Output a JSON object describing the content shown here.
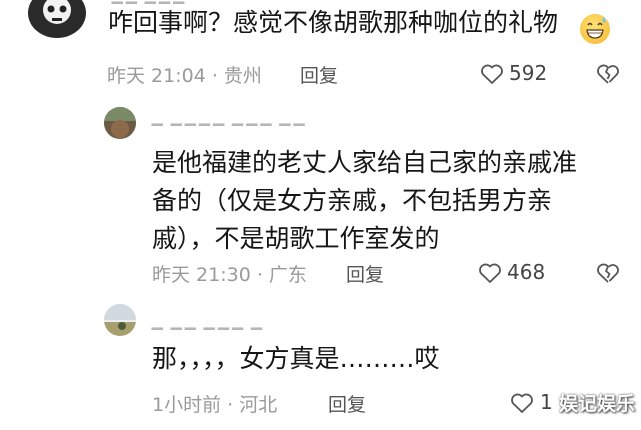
{
  "comments": [
    {
      "text_lines": [
        "咋回事啊？感觉不像胡歌那种咖位的礼物"
      ],
      "time": "昨天 21:04",
      "location": "贵州",
      "reply_label": "回复",
      "likes": "592"
    },
    {
      "text_lines": [
        "是他福建的老丈人家给自己家的亲戚准",
        "备的（仅是女方亲戚，不包括男方亲",
        "戚），不是胡歌工作室发的"
      ],
      "time": "昨天 21:30",
      "location": "广东",
      "reply_label": "回复",
      "likes": "468"
    },
    {
      "text_lines": [
        "那，，，，女方真是………哎"
      ],
      "time": "1小时前",
      "location": "河北",
      "reply_label": "回复",
      "likes": "1"
    }
  ],
  "meta_separator": " · ",
  "icons": {
    "like": "heart-outline-icon",
    "dislike": "broken-heart-icon",
    "emoji": "grinning-sweat-emoji-icon"
  },
  "watermark": "娱记娱乐"
}
